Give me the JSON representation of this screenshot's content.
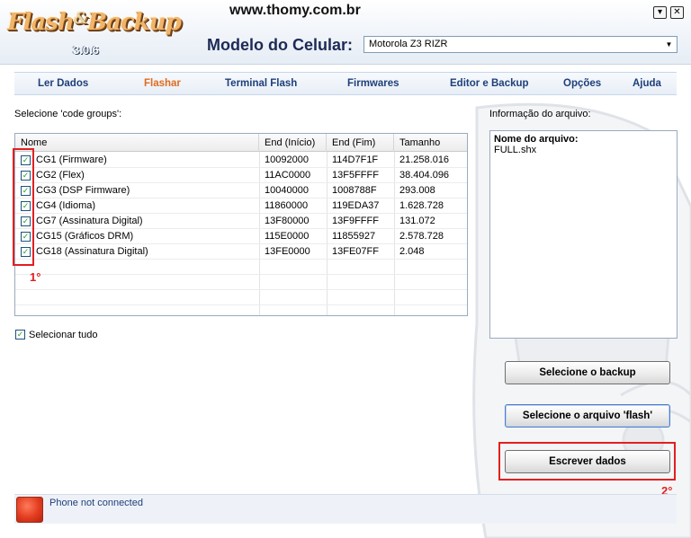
{
  "header": {
    "logo_text": "Flash",
    "logo_amp": "&",
    "logo_text2": "Backup",
    "version": "3.0.6",
    "site_url": "www.thomy.com.br",
    "minimize_label": "▾",
    "close_label": "✕",
    "model_label": "Modelo do Celular:",
    "model_value": "Motorola Z3 RIZR"
  },
  "nav": {
    "items": [
      "Ler Dados",
      "Flashar",
      "Terminal Flash",
      "Firmwares",
      "Editor e Backup",
      "Opções",
      "Ajuda"
    ],
    "active": "Flashar"
  },
  "code_groups": {
    "label": "Selecione 'code groups':",
    "columns": [
      "Nome",
      "End (Início)",
      "End (Fim)",
      "Tamanho"
    ],
    "rows": [
      {
        "name": "CG1 (Firmware)",
        "start": "10092000",
        "end": "114D7F1F",
        "size": "21.258.016",
        "checked": true
      },
      {
        "name": "CG2 (Flex)",
        "start": "11AC0000",
        "end": "13F5FFFF",
        "size": "38.404.096",
        "checked": true
      },
      {
        "name": "CG3 (DSP Firmware)",
        "start": "10040000",
        "end": "1008788F",
        "size": "293.008",
        "checked": true
      },
      {
        "name": "CG4 (Idioma)",
        "start": "11860000",
        "end": "119EDA37",
        "size": "1.628.728",
        "checked": true
      },
      {
        "name": "CG7 (Assinatura Digital)",
        "start": "13F80000",
        "end": "13F9FFFF",
        "size": "131.072",
        "checked": true
      },
      {
        "name": "CG15 (Gráficos DRM)",
        "start": "115E0000",
        "end": "11855927",
        "size": "2.578.728",
        "checked": true
      },
      {
        "name": "CG18 (Assinatura Digital)",
        "start": "13FE0000",
        "end": "13FE07FF",
        "size": "2.048",
        "checked": true
      }
    ],
    "select_all_label": "Selecionar tudo",
    "select_all_checked": true,
    "annotation_1": "1°"
  },
  "file_info": {
    "label": "Informação do arquivo:",
    "name_heading": "Nome do arquivo:",
    "name_value": "FULL.shx"
  },
  "buttons": {
    "select_backup": "Selecione o backup",
    "select_flash": "Selecione o arquivo 'flash'",
    "write_data": "Escrever dados",
    "annotation_2": "2°"
  },
  "status": {
    "text": "Phone not connected",
    "led_color": "#e23c1f"
  },
  "colors": {
    "accent": "#e06b1f",
    "nav_text": "#1e3f7a",
    "annotation": "#e02020"
  }
}
